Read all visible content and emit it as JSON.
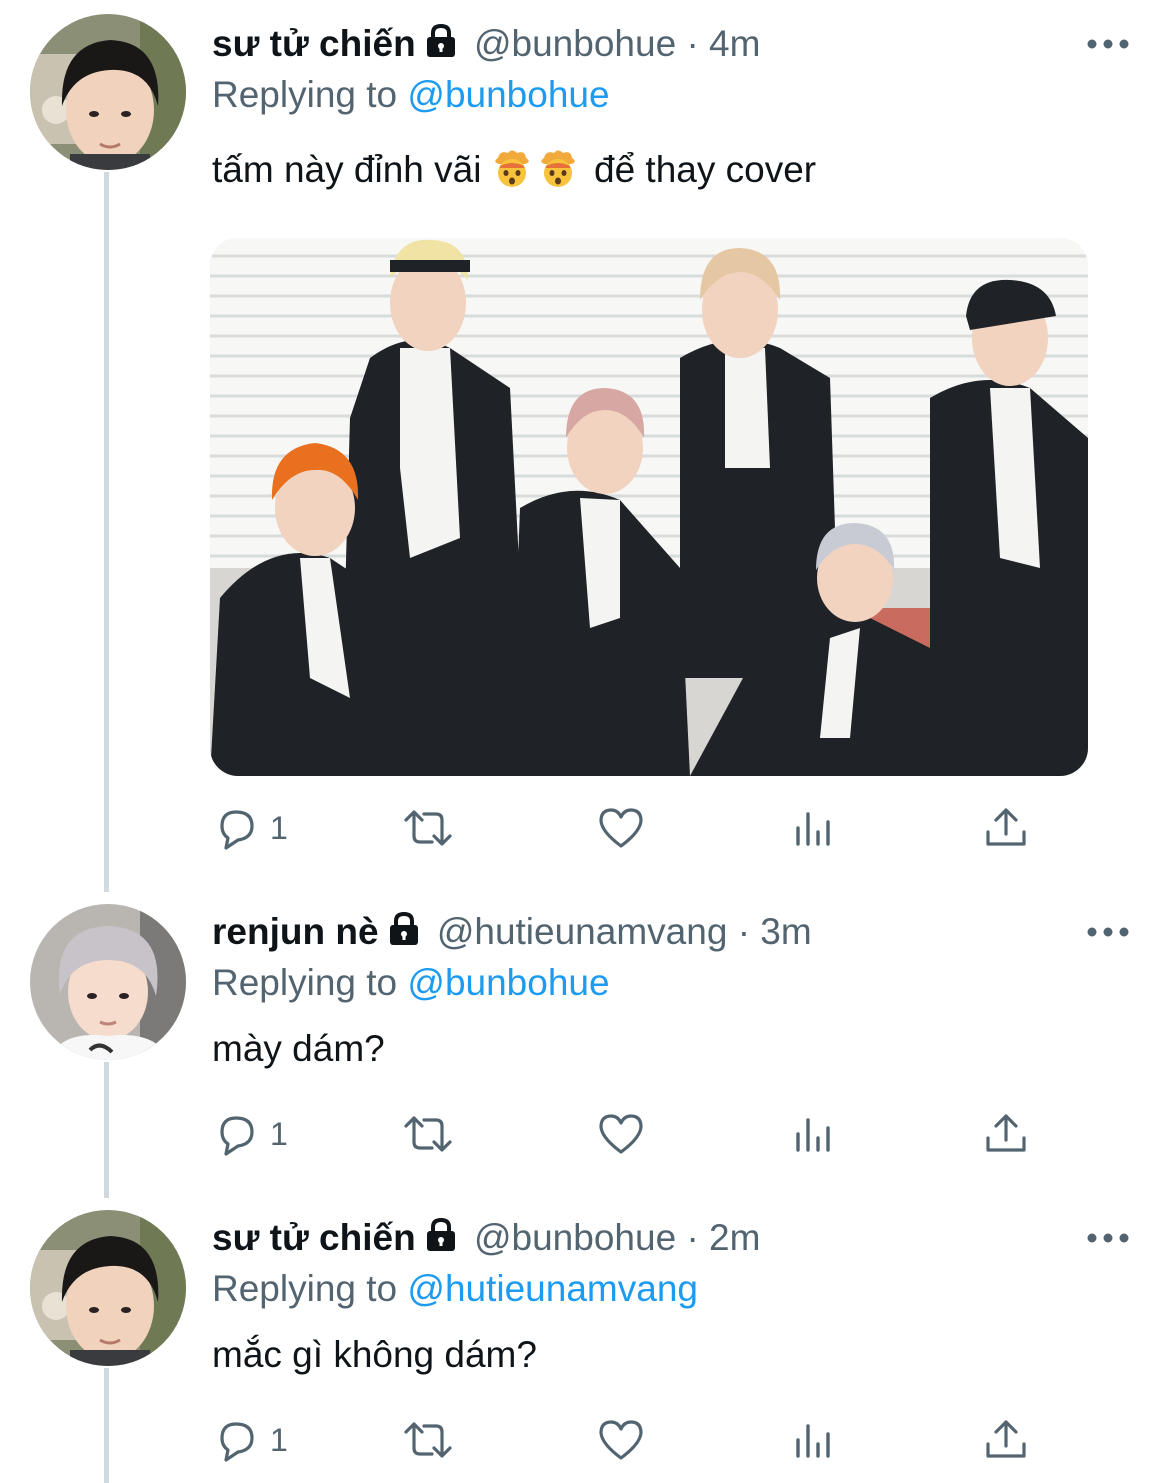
{
  "tweets": [
    {
      "name": "sư tử chiến",
      "handle": "@bunbohue",
      "separator": "·",
      "time": "4m",
      "replying_label": "Replying to",
      "replying_to": "@bunbohue",
      "text": "tấm này đỉnh vãi",
      "text_after_emoji": " để thay cover",
      "emoji": [
        "exploding-head-emoji",
        "exploding-head-emoji"
      ],
      "has_media": true,
      "reply_count": "1"
    },
    {
      "name": "renjun nè",
      "handle": "@hutieunamvang",
      "separator": "·",
      "time": "3m",
      "replying_label": "Replying to",
      "replying_to": "@bunbohue",
      "text": "mày dám?",
      "reply_count": "1"
    },
    {
      "name": "sư tử chiến",
      "handle": "@bunbohue",
      "separator": "·",
      "time": "2m",
      "replying_label": "Replying to",
      "replying_to": "@hutieunamvang",
      "text": "mắc gì không dám?",
      "reply_count": "1"
    }
  ],
  "icons": {
    "verified_lock": "lock-icon",
    "more": "more-icon",
    "reply": "reply-icon",
    "retweet": "retweet-icon",
    "like": "heart-icon",
    "analytics": "analytics-icon",
    "share": "share-icon"
  },
  "colors": {
    "link": "#1d9bf0",
    "secondary_text": "#536471",
    "thread_line": "#cfd9de"
  }
}
